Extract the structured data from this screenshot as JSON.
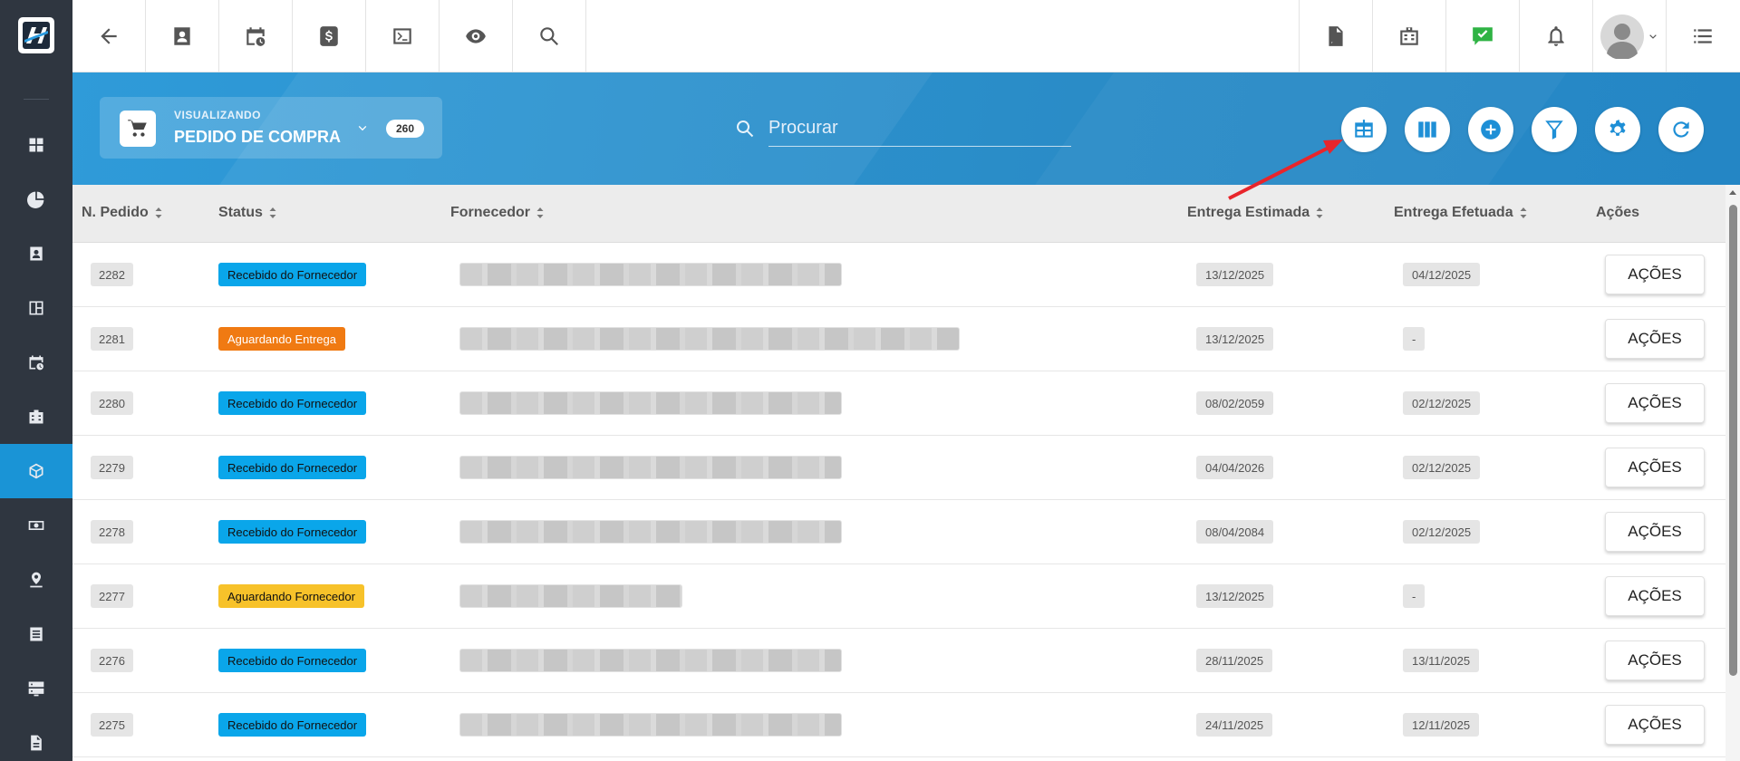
{
  "sidebar": {
    "items": [
      {
        "icon": "dashboard-grid-icon"
      },
      {
        "icon": "pie-chart-icon"
      },
      {
        "icon": "contact-card-icon"
      },
      {
        "icon": "board-icon"
      },
      {
        "icon": "calendar-clock-icon"
      },
      {
        "icon": "building-icon"
      },
      {
        "icon": "box-icon",
        "active": true
      },
      {
        "icon": "money-icon"
      },
      {
        "icon": "location-pin-icon"
      },
      {
        "icon": "list-icon"
      },
      {
        "icon": "server-icon"
      },
      {
        "icon": "document-icon"
      }
    ]
  },
  "topbar": {
    "left_buttons": [
      "back-arrow-icon",
      "contact-icon",
      "calendar-clock-icon",
      "dollar-icon",
      "terminal-icon",
      "eye-icon",
      "search-icon"
    ],
    "right_buttons": [
      "pdf-icon",
      "building-icon",
      "chat-check-icon",
      "bell-icon",
      "avatar",
      "menu-icon"
    ]
  },
  "header": {
    "view_caption": "VISUALIZANDO",
    "view_title": "PEDIDO DE COMPRA",
    "count": "260",
    "search_placeholder": "Procurar"
  },
  "table": {
    "columns": [
      "N. Pedido",
      "Status",
      "Fornecedor",
      "Entrega Estimada",
      "Entrega Efetuada",
      "Ações"
    ],
    "action_label": "AÇÕES",
    "rows": [
      {
        "id": "2282",
        "status": "Recebido do Fornecedor",
        "status_color": "blue",
        "supplier_width": 422,
        "estimada": "13/12/2025",
        "efetuada": "04/12/2025"
      },
      {
        "id": "2281",
        "status": "Aguardando Entrega",
        "status_color": "orange",
        "supplier_width": 552,
        "estimada": "13/12/2025",
        "efetuada": "-"
      },
      {
        "id": "2280",
        "status": "Recebido do Fornecedor",
        "status_color": "blue",
        "supplier_width": 422,
        "estimada": "08/02/2059",
        "efetuada": "02/12/2025"
      },
      {
        "id": "2279",
        "status": "Recebido do Fornecedor",
        "status_color": "blue",
        "supplier_width": 422,
        "estimada": "04/04/2026",
        "efetuada": "02/12/2025"
      },
      {
        "id": "2278",
        "status": "Recebido do Fornecedor",
        "status_color": "blue",
        "supplier_width": 422,
        "estimada": "08/04/2084",
        "efetuada": "02/12/2025"
      },
      {
        "id": "2277",
        "status": "Aguardando Fornecedor",
        "status_color": "yellow",
        "supplier_width": 246,
        "estimada": "13/12/2025",
        "efetuada": "-"
      },
      {
        "id": "2276",
        "status": "Recebido do Fornecedor",
        "status_color": "blue",
        "supplier_width": 422,
        "estimada": "28/11/2025",
        "efetuada": "13/11/2025"
      },
      {
        "id": "2275",
        "status": "Recebido do Fornecedor",
        "status_color": "blue",
        "supplier_width": 422,
        "estimada": "24/11/2025",
        "efetuada": "12/11/2025"
      }
    ]
  },
  "colors": {
    "accent": "#1a94d6",
    "sidebar": "#2f3640",
    "status_blue": "#0aa6ea",
    "status_orange": "#f07a12",
    "status_yellow": "#f7c22a",
    "annotation_arrow": "#e8252b"
  }
}
